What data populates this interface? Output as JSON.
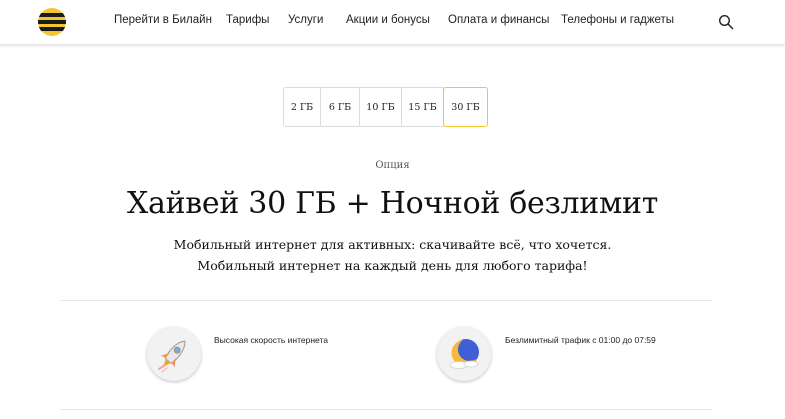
{
  "header": {
    "nav": [
      {
        "label": "Перейти в Билайн"
      },
      {
        "label": "Тарифы"
      },
      {
        "label": "Услуги"
      },
      {
        "label": "Акции и бонусы"
      },
      {
        "label": "Оплата и финансы"
      },
      {
        "label": "Телефоны и гаджеты"
      }
    ],
    "colors": {
      "brand_yellow": "#f2c531",
      "brand_black": "#1a1a1a"
    }
  },
  "tabs": {
    "items": [
      {
        "label": "2 ГБ"
      },
      {
        "label": "6 ГБ"
      },
      {
        "label": "10 ГБ"
      },
      {
        "label": "15 ГБ"
      },
      {
        "label": "30 ГБ"
      }
    ],
    "selected": "30 ГБ"
  },
  "main": {
    "option_label": "Опция",
    "title": "Хайвей 30 ГБ + Ночной безлимит",
    "description_line1": "Мобильный интернет для активных: скачивайте всё, что хочется.",
    "description_line2": "Мобильный интернет на каждый день для любого тарифа!"
  },
  "features": [
    {
      "icon": "rocket-icon",
      "text": "Высокая скорость интернета"
    },
    {
      "icon": "moon-icon",
      "text": "Безлимитный трафик с 01:00 до 07:59"
    }
  ]
}
